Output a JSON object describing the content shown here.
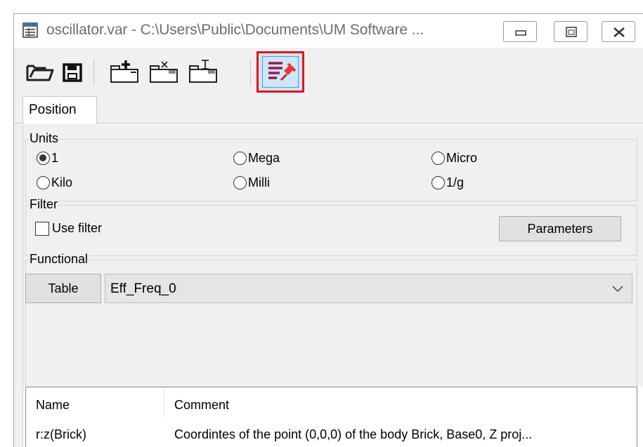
{
  "window": {
    "title": "oscillator.var - C:\\Users\\Public\\Documents\\UM Software ...",
    "controls": [
      "minimize",
      "maximize",
      "close"
    ]
  },
  "toolbar": {
    "buttons": [
      {
        "icon": "open-folder-icon",
        "tooltip": ""
      },
      {
        "icon": "save-icon",
        "tooltip": ""
      },
      {
        "icon": "add-variable-icon",
        "tooltip": ""
      },
      {
        "icon": "delete-variable-icon",
        "tooltip": ""
      },
      {
        "icon": "rename-variable-icon",
        "tooltip": ""
      },
      {
        "icon": "pin-list-icon",
        "tooltip": ""
      }
    ],
    "highlight_color": "#e0161e"
  },
  "tabs": [
    {
      "label": "Position",
      "selected": true
    }
  ],
  "units": {
    "title": "Units",
    "options": [
      "1",
      "Mega",
      "Micro",
      "Kilo",
      "Milli",
      "1/g"
    ],
    "selected": "1"
  },
  "filter": {
    "title": "Filter",
    "use_filter_label": "Use filter",
    "use_filter_checked": false,
    "parameters_label": "Parameters"
  },
  "functional": {
    "title": "Functional",
    "table_label": "Table",
    "selected_value": "Eff_Freq_0"
  },
  "list": {
    "columns": [
      "Name",
      "Comment"
    ],
    "rows": [
      {
        "name": "r:z(Brick)",
        "comment": "Coordintes of the point (0,0,0) of the body Brick, Base0, Z proj..."
      }
    ]
  }
}
